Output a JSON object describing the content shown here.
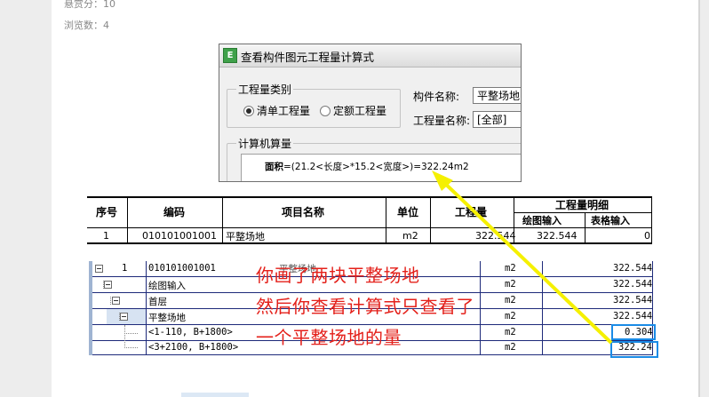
{
  "meta": {
    "reward_label": "悬赏分：10",
    "views_label": "浏览数：4"
  },
  "dialog": {
    "title": "查看构件图元工程量计算式",
    "icon_letter": "E",
    "quantity_type_label": "工程量类别",
    "radio_bill": "清单工程量",
    "radio_quota": "定额工程量",
    "component_name_label": "构件名称:",
    "component_name_value": "平整场地",
    "quantity_name_label": "工程量名称:",
    "quantity_name_value": "[全部]",
    "calc_label": "计算机算量",
    "formula_bold": "面积",
    "formula_rest": "=(21.2<长度>*15.2<宽度>)=322.24m2"
  },
  "table1": {
    "headers": {
      "seq": "序号",
      "code": "编码",
      "name": "项目名称",
      "unit": "单位",
      "qty": "工程量",
      "detail": "工程量明细",
      "draw_input": "绘图输入",
      "table_input": "表格输入"
    },
    "row": {
      "seq": "1",
      "code": "010101001001",
      "name": "平整场地",
      "unit": "m2",
      "qty": "322.544",
      "draw_input": "322.544",
      "table_input": "0"
    }
  },
  "table2": {
    "rows": [
      {
        "seq": "1",
        "name": "010101001001",
        "unit": "",
        "qty": "322.544"
      },
      {
        "name": "绘图输入",
        "unit": "m2",
        "qty": "322.544"
      },
      {
        "name": "首层",
        "unit": "m2",
        "qty": "322.544"
      },
      {
        "name": "平整场地",
        "unit": "m2",
        "qty": "322.544"
      },
      {
        "name": "<1-110, B+1800>",
        "unit": "m2",
        "qty": "0.304"
      },
      {
        "name": "<3+2100, B+1800>",
        "unit": "m2",
        "qty": "322.24"
      }
    ],
    "row1_item_name": "平整场地",
    "row1_unit": "m2"
  },
  "annotation": {
    "line1": "你画了两块平整场地",
    "line2": "然后你查看计算式只查看了",
    "line3": "一个平整场地的量"
  },
  "colors": {
    "annotation": "#e4201a",
    "arrow": "#f5f000",
    "highlight_box": "#1a8be6",
    "table2_lines": "#1e2a7a"
  }
}
